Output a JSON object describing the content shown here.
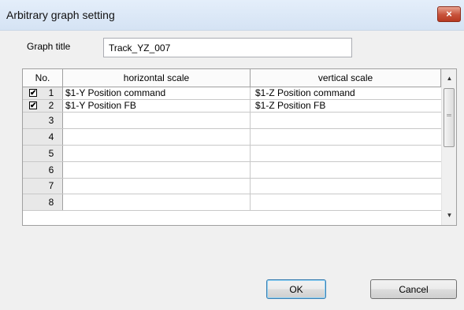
{
  "window": {
    "title": "Arbitrary graph setting",
    "close_glyph": "×"
  },
  "form": {
    "graph_title_label": "Graph title",
    "graph_title_value": "Track_YZ_007"
  },
  "table": {
    "headers": {
      "no": "No.",
      "horizontal": "horizontal scale",
      "vertical": "vertical scale"
    },
    "rows": [
      {
        "no": "1",
        "checked": true,
        "horizontal": "$1-Y Position command",
        "vertical": "$1-Z Position command"
      },
      {
        "no": "2",
        "checked": true,
        "horizontal": "$1-Y Position FB",
        "vertical": "$1-Z Position FB"
      },
      {
        "no": "3",
        "checked": false,
        "horizontal": "",
        "vertical": ""
      },
      {
        "no": "4",
        "checked": false,
        "horizontal": "",
        "vertical": ""
      },
      {
        "no": "5",
        "checked": false,
        "horizontal": "",
        "vertical": ""
      },
      {
        "no": "6",
        "checked": false,
        "horizontal": "",
        "vertical": ""
      },
      {
        "no": "7",
        "checked": false,
        "horizontal": "",
        "vertical": ""
      },
      {
        "no": "8",
        "checked": false,
        "horizontal": "",
        "vertical": ""
      }
    ],
    "check_glyph": "✔"
  },
  "buttons": {
    "ok": "OK",
    "cancel": "Cancel"
  },
  "icons": {
    "close": "close-icon",
    "scroll_up": "scroll-up-icon",
    "scroll_down": "scroll-down-icon"
  }
}
